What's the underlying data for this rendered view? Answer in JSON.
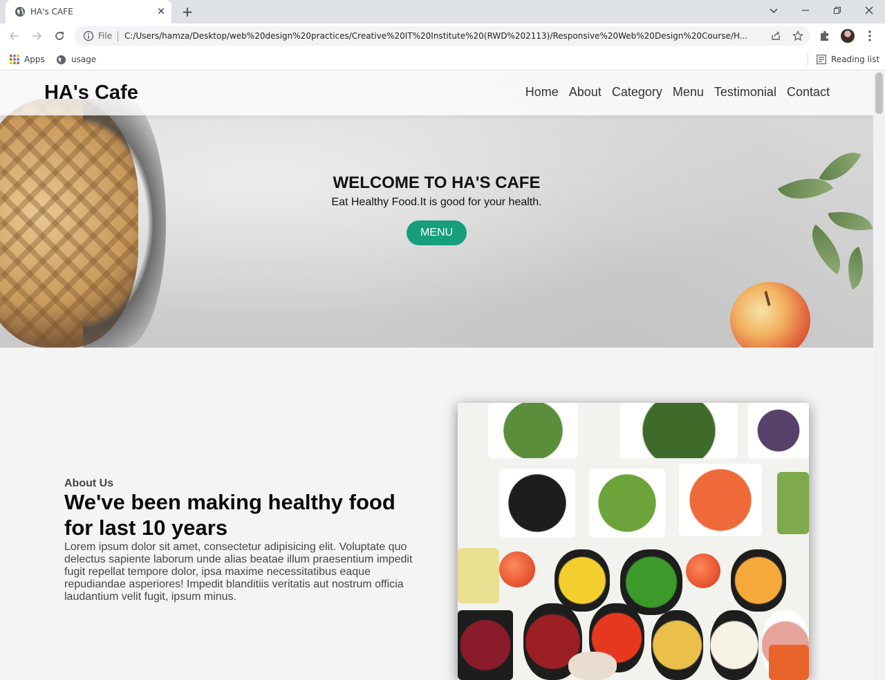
{
  "browser": {
    "tab_title": "HA's CAFE",
    "new_tab": "+",
    "close_tab": "✕",
    "file_label": "File",
    "url": "C:/Users/hamza/Desktop/web%20design%20practices/Creative%20IT%20Institute%20(RWD%202113)/Responsive%20Web%20Design%20Course/H...",
    "bookmarks": [
      {
        "label": "Apps"
      },
      {
        "label": "usage"
      }
    ],
    "reading_list": "Reading list"
  },
  "site": {
    "brand": "HA's Cafe",
    "nav": [
      "Home",
      "About",
      "Category",
      "Menu",
      "Testimonial",
      "Contact"
    ],
    "hero": {
      "title": "WELCOME TO HA'S CAFE",
      "subtitle": "Eat Healthy Food.It is good for your health.",
      "button": "MENU"
    },
    "about": {
      "subtitle": "About Us",
      "title": "We've been making healthy food for last 10 years",
      "text": "Lorem ipsum dolor sit amet, consectetur adipisicing elit. Voluptate quo delectus sapiente laborum unde alias beatae illum praesentium impedit fugit repellat tempore dolor, ipsa maxime necessitatibus eaque repudiandae asperiores! Impedit blanditiis veritatis aut nostrum officia laudantium velit fugit, ipsum minus."
    }
  },
  "colors": {
    "accent": "#169e7d",
    "tabstrip": "#dee1e6"
  }
}
